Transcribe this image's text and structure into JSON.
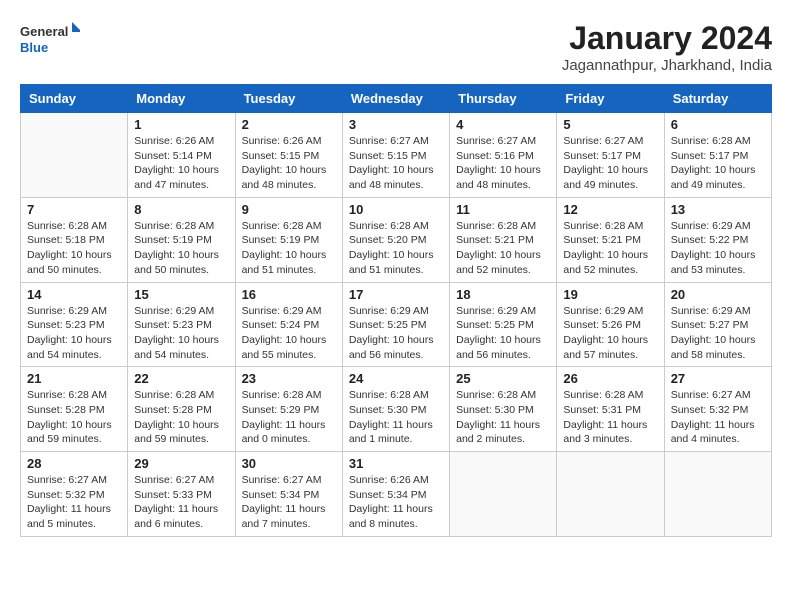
{
  "header": {
    "logo_general": "General",
    "logo_blue": "Blue",
    "month_title": "January 2024",
    "location": "Jagannathpur, Jharkhand, India"
  },
  "days_of_week": [
    "Sunday",
    "Monday",
    "Tuesday",
    "Wednesday",
    "Thursday",
    "Friday",
    "Saturday"
  ],
  "weeks": [
    [
      {
        "day": "",
        "info": ""
      },
      {
        "day": "1",
        "info": "Sunrise: 6:26 AM\nSunset: 5:14 PM\nDaylight: 10 hours\nand 47 minutes."
      },
      {
        "day": "2",
        "info": "Sunrise: 6:26 AM\nSunset: 5:15 PM\nDaylight: 10 hours\nand 48 minutes."
      },
      {
        "day": "3",
        "info": "Sunrise: 6:27 AM\nSunset: 5:15 PM\nDaylight: 10 hours\nand 48 minutes."
      },
      {
        "day": "4",
        "info": "Sunrise: 6:27 AM\nSunset: 5:16 PM\nDaylight: 10 hours\nand 48 minutes."
      },
      {
        "day": "5",
        "info": "Sunrise: 6:27 AM\nSunset: 5:17 PM\nDaylight: 10 hours\nand 49 minutes."
      },
      {
        "day": "6",
        "info": "Sunrise: 6:28 AM\nSunset: 5:17 PM\nDaylight: 10 hours\nand 49 minutes."
      }
    ],
    [
      {
        "day": "7",
        "info": "Sunrise: 6:28 AM\nSunset: 5:18 PM\nDaylight: 10 hours\nand 50 minutes."
      },
      {
        "day": "8",
        "info": "Sunrise: 6:28 AM\nSunset: 5:19 PM\nDaylight: 10 hours\nand 50 minutes."
      },
      {
        "day": "9",
        "info": "Sunrise: 6:28 AM\nSunset: 5:19 PM\nDaylight: 10 hours\nand 51 minutes."
      },
      {
        "day": "10",
        "info": "Sunrise: 6:28 AM\nSunset: 5:20 PM\nDaylight: 10 hours\nand 51 minutes."
      },
      {
        "day": "11",
        "info": "Sunrise: 6:28 AM\nSunset: 5:21 PM\nDaylight: 10 hours\nand 52 minutes."
      },
      {
        "day": "12",
        "info": "Sunrise: 6:28 AM\nSunset: 5:21 PM\nDaylight: 10 hours\nand 52 minutes."
      },
      {
        "day": "13",
        "info": "Sunrise: 6:29 AM\nSunset: 5:22 PM\nDaylight: 10 hours\nand 53 minutes."
      }
    ],
    [
      {
        "day": "14",
        "info": "Sunrise: 6:29 AM\nSunset: 5:23 PM\nDaylight: 10 hours\nand 54 minutes."
      },
      {
        "day": "15",
        "info": "Sunrise: 6:29 AM\nSunset: 5:23 PM\nDaylight: 10 hours\nand 54 minutes."
      },
      {
        "day": "16",
        "info": "Sunrise: 6:29 AM\nSunset: 5:24 PM\nDaylight: 10 hours\nand 55 minutes."
      },
      {
        "day": "17",
        "info": "Sunrise: 6:29 AM\nSunset: 5:25 PM\nDaylight: 10 hours\nand 56 minutes."
      },
      {
        "day": "18",
        "info": "Sunrise: 6:29 AM\nSunset: 5:25 PM\nDaylight: 10 hours\nand 56 minutes."
      },
      {
        "day": "19",
        "info": "Sunrise: 6:29 AM\nSunset: 5:26 PM\nDaylight: 10 hours\nand 57 minutes."
      },
      {
        "day": "20",
        "info": "Sunrise: 6:29 AM\nSunset: 5:27 PM\nDaylight: 10 hours\nand 58 minutes."
      }
    ],
    [
      {
        "day": "21",
        "info": "Sunrise: 6:28 AM\nSunset: 5:28 PM\nDaylight: 10 hours\nand 59 minutes."
      },
      {
        "day": "22",
        "info": "Sunrise: 6:28 AM\nSunset: 5:28 PM\nDaylight: 10 hours\nand 59 minutes."
      },
      {
        "day": "23",
        "info": "Sunrise: 6:28 AM\nSunset: 5:29 PM\nDaylight: 11 hours\nand 0 minutes."
      },
      {
        "day": "24",
        "info": "Sunrise: 6:28 AM\nSunset: 5:30 PM\nDaylight: 11 hours\nand 1 minute."
      },
      {
        "day": "25",
        "info": "Sunrise: 6:28 AM\nSunset: 5:30 PM\nDaylight: 11 hours\nand 2 minutes."
      },
      {
        "day": "26",
        "info": "Sunrise: 6:28 AM\nSunset: 5:31 PM\nDaylight: 11 hours\nand 3 minutes."
      },
      {
        "day": "27",
        "info": "Sunrise: 6:27 AM\nSunset: 5:32 PM\nDaylight: 11 hours\nand 4 minutes."
      }
    ],
    [
      {
        "day": "28",
        "info": "Sunrise: 6:27 AM\nSunset: 5:32 PM\nDaylight: 11 hours\nand 5 minutes."
      },
      {
        "day": "29",
        "info": "Sunrise: 6:27 AM\nSunset: 5:33 PM\nDaylight: 11 hours\nand 6 minutes."
      },
      {
        "day": "30",
        "info": "Sunrise: 6:27 AM\nSunset: 5:34 PM\nDaylight: 11 hours\nand 7 minutes."
      },
      {
        "day": "31",
        "info": "Sunrise: 6:26 AM\nSunset: 5:34 PM\nDaylight: 11 hours\nand 8 minutes."
      },
      {
        "day": "",
        "info": ""
      },
      {
        "day": "",
        "info": ""
      },
      {
        "day": "",
        "info": ""
      }
    ]
  ]
}
